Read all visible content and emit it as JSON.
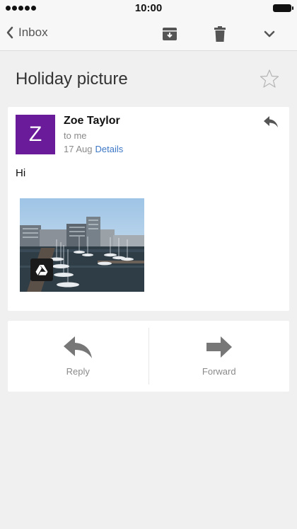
{
  "status_bar": {
    "time": "10:00",
    "icons": [
      "signal-dots-icon",
      "battery-icon"
    ]
  },
  "toolbar": {
    "back_label": "Inbox",
    "icons": [
      "chevron-left-icon",
      "archive-icon",
      "trash-icon",
      "chevron-down-icon"
    ]
  },
  "subject": "Holiday picture",
  "message": {
    "avatar_letter": "Z",
    "avatar_color": "#6a1b9a",
    "sender": "Zoe Taylor",
    "to": "to me",
    "date": "17 Aug",
    "details_link": "Details",
    "body": "Hi",
    "attachment_icon": "drive-icon"
  },
  "actions": {
    "reply_label": "Reply",
    "forward_label": "Forward"
  },
  "colors": {
    "link": "#3d78c6",
    "background": "#f0f0f0"
  }
}
